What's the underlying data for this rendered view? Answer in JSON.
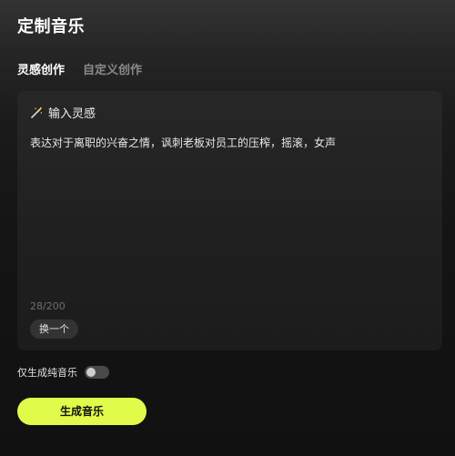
{
  "header": {
    "title": "定制音乐"
  },
  "tabs": [
    {
      "label": "灵感创作",
      "active": true
    },
    {
      "label": "自定义创作",
      "active": false
    }
  ],
  "inspiration_card": {
    "header_label": "输入灵感",
    "header_icon": "magic-wand-icon",
    "prompt_text": "表达对于离职的兴奋之情，讽刺老板对员工的压榨，摇滚，女声",
    "char_count": "28/200",
    "refresh_label": "换一个"
  },
  "options": {
    "instrumental_label": "仅生成纯音乐",
    "instrumental_enabled": false
  },
  "actions": {
    "generate_label": "生成音乐"
  },
  "colors": {
    "accent": "#e2fb4a",
    "background": "#141414",
    "card": "#222222"
  }
}
